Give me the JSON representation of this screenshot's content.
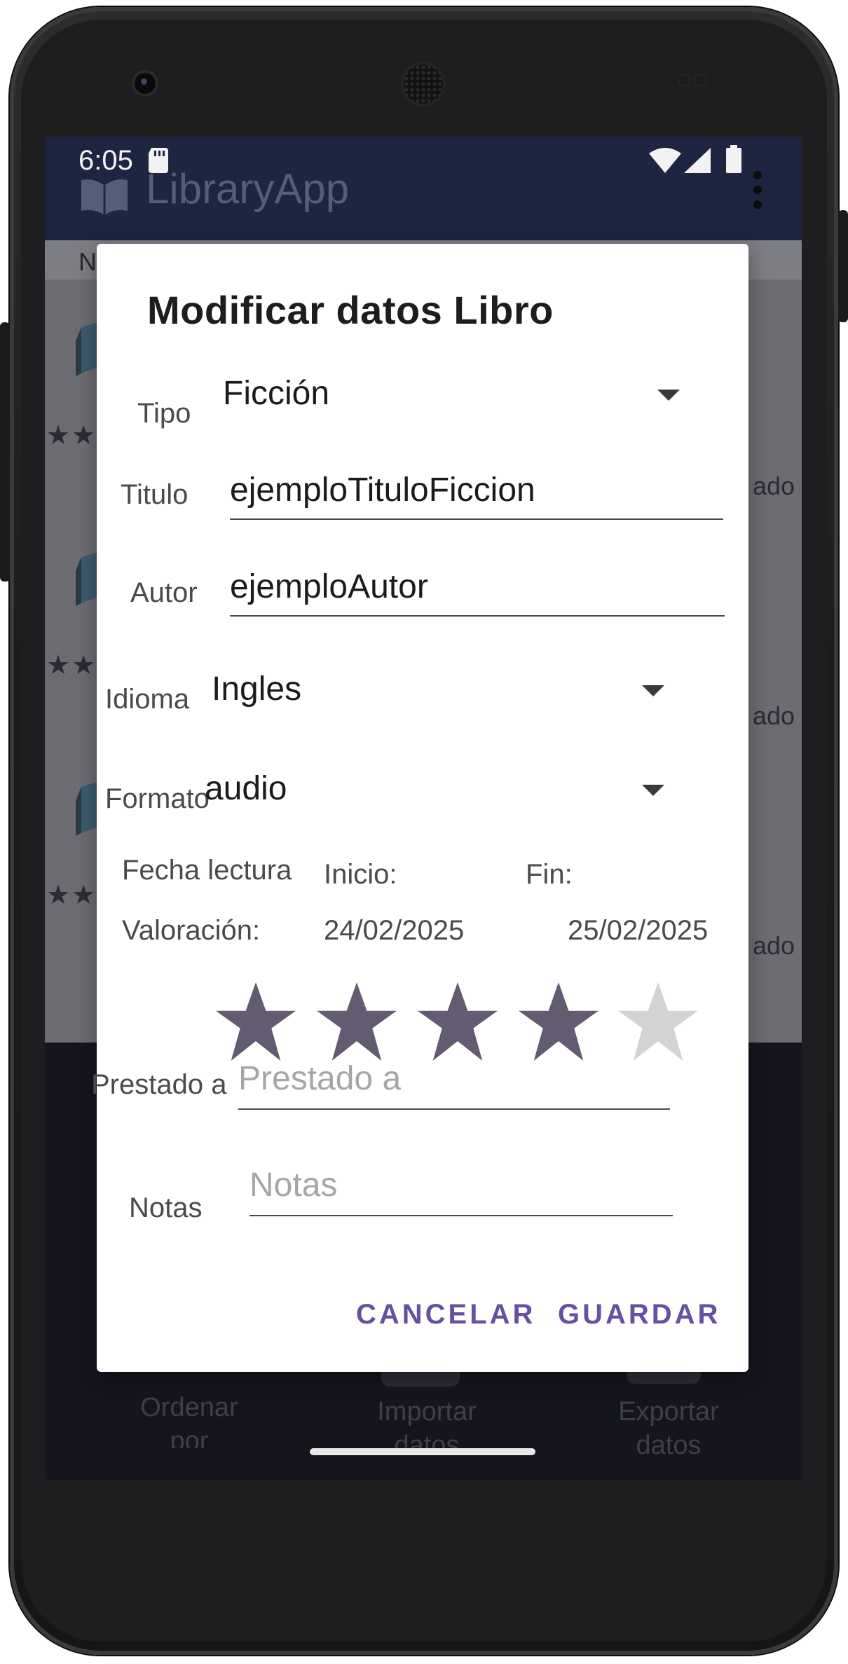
{
  "status_bar": {
    "time": "6:05"
  },
  "app_bar": {
    "title": "LibraryApp"
  },
  "list": {
    "header_fragment": "N",
    "rows": [
      {
        "trailing": "ado"
      },
      {
        "trailing": "ado"
      },
      {
        "trailing": "ado"
      }
    ]
  },
  "bottom_nav": {
    "items": [
      {
        "label": "Ordenar por"
      },
      {
        "label": "Importar datos"
      },
      {
        "label": "Exportar datos"
      }
    ]
  },
  "dialog": {
    "title": "Modificar datos Libro",
    "tipo": {
      "label": "Tipo",
      "value": "Ficción"
    },
    "titulo": {
      "label": "Titulo",
      "value": "ejemploTituloFiccion"
    },
    "autor": {
      "label": "Autor",
      "value": "ejemploAutor"
    },
    "idioma": {
      "label": "Idioma",
      "value": "Ingles"
    },
    "formato": {
      "label": "Formato",
      "value": "audio"
    },
    "fecha": {
      "label": "Fecha lectura",
      "inicio_label": "Inicio:",
      "fin_label": "Fin:",
      "inicio_value": "24/02/2025",
      "fin_value": "25/02/2025"
    },
    "valoracion": {
      "label": "Valoración:",
      "rating": 4,
      "max": 5
    },
    "prestado": {
      "label": "Prestado a",
      "placeholder": "Prestado a",
      "value": ""
    },
    "notas": {
      "label": "Notas",
      "placeholder": "Notas",
      "value": ""
    },
    "buttons": {
      "cancel": "CANCELAR",
      "save": "GUARDAR"
    }
  },
  "colors": {
    "star_filled": "#625b71",
    "star_empty": "#d3d3d3",
    "accent": "#6750a4",
    "app_bar": "#1e2540"
  }
}
